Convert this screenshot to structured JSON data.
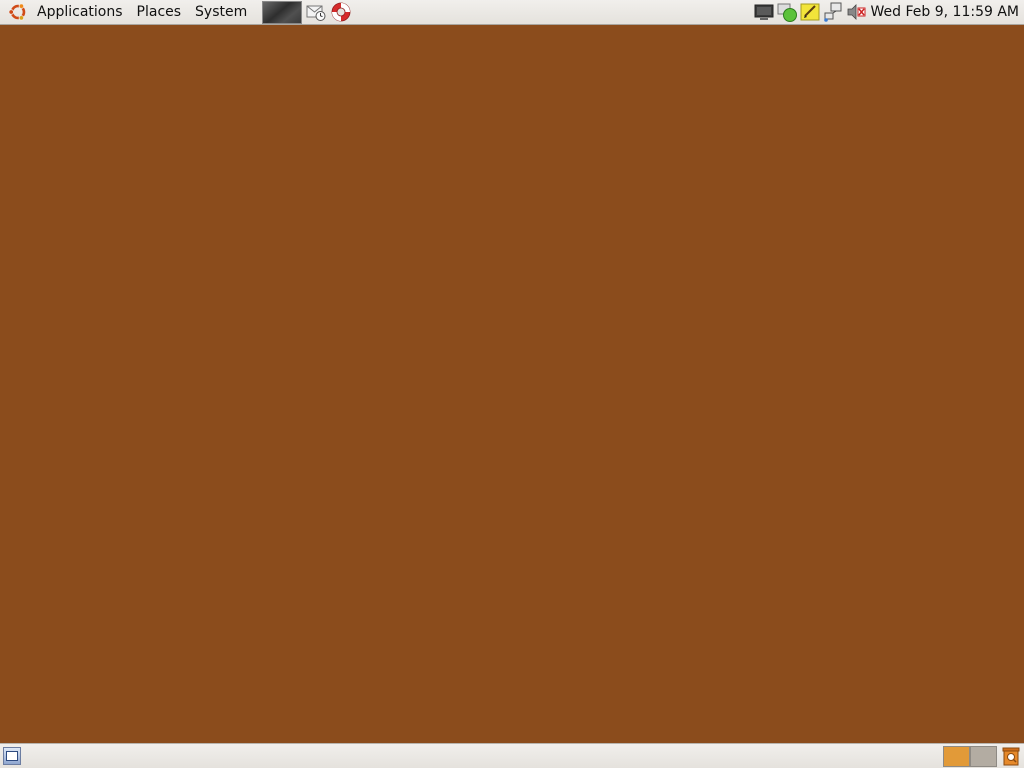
{
  "top_panel": {
    "menus": [
      {
        "label": "Applications"
      },
      {
        "label": "Places"
      },
      {
        "label": "System"
      }
    ],
    "logo_icon": "ubuntu-logo-icon",
    "launchers": [
      {
        "icon": "mail-icon"
      },
      {
        "icon": "help-lifebuoy-icon"
      }
    ],
    "tray_icons": [
      {
        "icon": "monitor-icon"
      },
      {
        "icon": "network-status-icon"
      },
      {
        "icon": "notes-pencil-icon"
      },
      {
        "icon": "network-manager-icon"
      },
      {
        "icon": "volume-muted-icon"
      }
    ],
    "clock": "Wed Feb  9, 11:59 AM"
  },
  "desktop": {
    "background_color": "#8b4c1c"
  },
  "bottom_panel": {
    "show_desktop_icon": "show-desktop-icon",
    "workspaces": [
      {
        "state": "active",
        "color": "#e29a38"
      },
      {
        "state": "inactive",
        "color": "#b3aca2"
      }
    ],
    "trash_icon": "trash-icon"
  }
}
